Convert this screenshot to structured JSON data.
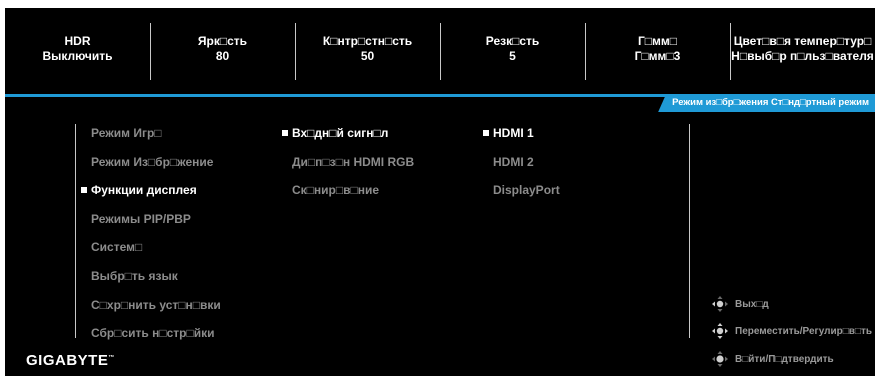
{
  "status_bar": [
    {
      "title": "HDR",
      "value": "Выключить"
    },
    {
      "title": "Ярк□сть",
      "value": "80"
    },
    {
      "title": "К□нтр□стн□сть",
      "value": "50"
    },
    {
      "title": "Резк□сть",
      "value": "5"
    },
    {
      "title": "Г□мм□",
      "value": "Г□мм□3"
    },
    {
      "title": "Цвет□в□я темпер□тур□",
      "value": "Н□выб□р п□льз□вателя"
    }
  ],
  "mode_tab": "Режим из□бр□жения  Ст□нд□ртный режим",
  "menu_main": [
    {
      "label": "Режим Игр□",
      "active": false
    },
    {
      "label": "Режим Из□бр□жение",
      "active": false
    },
    {
      "label": "Функции дисплея",
      "active": true
    },
    {
      "label": "Режимы PIP/PBP",
      "active": false
    },
    {
      "label": "Систем□",
      "active": false
    },
    {
      "label": "Выбр□ть язык",
      "active": false
    },
    {
      "label": "С□хр□нить уст□н□вки",
      "active": false
    },
    {
      "label": "Сбр□сить н□стр□йки",
      "active": false
    }
  ],
  "menu_sub": [
    {
      "label": "Вх□дн□й сигн□л",
      "active": true
    },
    {
      "label": "Ди□п□з□н HDMI RGB",
      "active": false
    },
    {
      "label": "Ск□нир□в□ние",
      "active": false
    }
  ],
  "menu_options": [
    {
      "label": "HDMI 1",
      "active": true
    },
    {
      "label": "HDMI 2",
      "active": false
    },
    {
      "label": "DisplayPort",
      "active": false
    }
  ],
  "nav_hints": [
    {
      "icon": "joystick-left-icon",
      "label": "Вых□д"
    },
    {
      "icon": "joystick-move-icon",
      "label": "Переместить/Регулир□в□ть"
    },
    {
      "icon": "joystick-press-icon",
      "label": "В□йти/П□дтвердить"
    }
  ],
  "brand": "GIGABYTE",
  "brand_mark": "™",
  "colors": {
    "accent": "#1f9ad6",
    "background": "#000000"
  }
}
